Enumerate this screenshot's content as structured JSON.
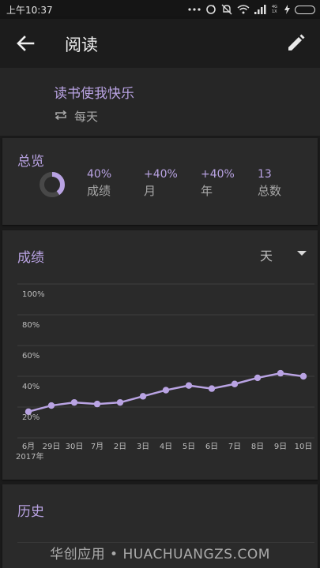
{
  "status_bar": {
    "time": "上午10:37",
    "network_label": "4G 1X"
  },
  "app_bar": {
    "title": "阅读",
    "back_icon": "arrow-left-icon",
    "edit_icon": "pencil-icon"
  },
  "habit": {
    "name": "读书使我快乐",
    "frequency": "每天",
    "frequency_icon": "repeat-icon"
  },
  "overview": {
    "title": "总览",
    "score_ring_fraction": 0.4,
    "stats": [
      {
        "value": "40%",
        "label": "成绩"
      },
      {
        "value": "+40%",
        "label": "月"
      },
      {
        "value": "+40%",
        "label": "年"
      },
      {
        "value": "13",
        "label": "总数"
      }
    ]
  },
  "score_card": {
    "title": "成绩",
    "range": "天"
  },
  "chart_data": {
    "type": "line",
    "categories": [
      "6月",
      "29日",
      "30日",
      "7月",
      "2日",
      "3日",
      "4日",
      "5日",
      "6日",
      "7日",
      "8日",
      "9日",
      "10日"
    ],
    "x_sublabel": "2017年",
    "values": [
      0.17,
      0.21,
      0.23,
      0.22,
      0.23,
      0.27,
      0.31,
      0.34,
      0.32,
      0.35,
      0.39,
      0.42,
      0.4
    ],
    "y_ticks": [
      "100%",
      "80%",
      "60%",
      "40%",
      "20%"
    ],
    "ylim": [
      0,
      1
    ],
    "grid": true,
    "line_color": "#b9a3e3"
  },
  "history": {
    "title": "历史"
  },
  "watermark": "华创应用 • HUACHUANGZS.COM"
}
